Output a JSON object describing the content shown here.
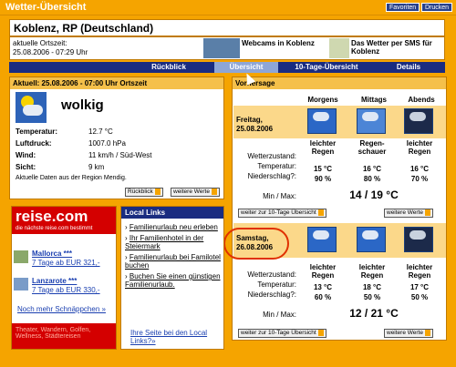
{
  "window": {
    "title": "Wetter-Übersicht",
    "btn_fav": "Favoriten",
    "btn_print": "Drucken"
  },
  "location": {
    "name": "Koblenz, RP (Deutschland)",
    "time_label": "aktuelle Ortszeit:",
    "time_value": "25.08.2006 - 07:29 Uhr"
  },
  "promo": {
    "webcams": "Webcams in Koblenz",
    "sms": "Das Wetter per SMS für Koblenz"
  },
  "nav": [
    "Rückblick",
    "Übersicht",
    "10-Tage-Übersicht",
    "Details"
  ],
  "current": {
    "header": "Aktuell: 25.08.2006 - 07:00 Uhr Ortszeit",
    "condition": "wolkig",
    "rows": [
      {
        "label": "Temperatur:",
        "value": "12.7 °C"
      },
      {
        "label": "Luftdruck:",
        "value": "1007.0 hPa"
      },
      {
        "label": "Wind:",
        "value": "11 km/h / Süd-West"
      },
      {
        "label": "Sicht:",
        "value": "9 km"
      }
    ],
    "note": "Aktuelle Daten aus der Region Mendig.",
    "btn_back": "Rückblick",
    "btn_more": "weitere Werte"
  },
  "forecast": {
    "header": "Vorhersage",
    "cols": [
      "Morgens",
      "Mittags",
      "Abends"
    ],
    "labels": [
      "Wetterzustand:",
      "Temperatur:",
      "Niederschlag?:"
    ],
    "minmax_label": "Min / Max:",
    "btn_10": "weiter zur 10-Tage Übersicht",
    "btn_more": "weitere Werte",
    "days": [
      {
        "day": "Freitag,",
        "date": "25.08.2006",
        "conds": [
          "leichter Regen",
          "Regen-schauer",
          "leichter Regen"
        ],
        "temps": [
          "15 °C",
          "16 °C",
          "16 °C"
        ],
        "precip": [
          "90 %",
          "80 %",
          "70 %"
        ],
        "minmax": "14 / 19 °C"
      },
      {
        "day": "Samstag,",
        "date": "26.08.2006",
        "conds": [
          "leichter Regen",
          "leichter Regen",
          "leichter Regen"
        ],
        "temps": [
          "13 °C",
          "18 °C",
          "17 °C"
        ],
        "precip": [
          "60 %",
          "50 %",
          "50 %"
        ],
        "minmax": "12 / 21 °C"
      }
    ]
  },
  "ad": {
    "brand": "reise.com",
    "slogan": "die nächste reise.com bestimmt",
    "offers": [
      {
        "place": "Mallorca ***",
        "price": "7 Tage ab EUR 321,-"
      },
      {
        "place": "Lanzarote ***",
        "price": "7 Tage ab EUR 330,-"
      }
    ],
    "more": "Noch mehr Schnäppchen »",
    "footer": "Theater, Wandern, Golfen, Wellness, Städtereisen"
  },
  "local": {
    "header": "Local Links",
    "items": [
      "Familienurlaub neu erleben",
      "Ihr Familienhotel in der Steiermark",
      "Familienurlaub bei Familotel buchen",
      "Buchen Sie einen günstigen Familienurlaub."
    ],
    "footer": "Ihre Seite bei den Local Links?»"
  }
}
